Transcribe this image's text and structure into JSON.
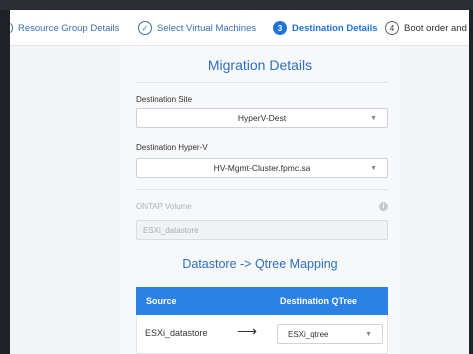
{
  "wizard": {
    "steps": [
      {
        "number": "",
        "label": "Resource Group Details",
        "state": "done"
      },
      {
        "number": "✓",
        "label": "Select Virtual Machines",
        "state": "done"
      },
      {
        "number": "3",
        "label": "Destination Details",
        "state": "active"
      },
      {
        "number": "4",
        "label": "Boot order and",
        "state": "pending"
      }
    ]
  },
  "form": {
    "title": "Migration Details",
    "destination_site": {
      "label": "Destination Site",
      "value": "HyperV-Dest"
    },
    "destination_hyperv": {
      "label": "Destination Hyper-V",
      "value": "HV-Mgmt-Cluster.fpmc.sa"
    },
    "ontap_volume": {
      "label": "ONTAP Volume",
      "placeholder": "ESXi_datastore",
      "info_icon": "i"
    }
  },
  "mapping": {
    "title": "Datastore -> Qtree Mapping",
    "columns": [
      "Source",
      "Destination QTree"
    ],
    "rows": [
      {
        "source": "ESXi_datastore",
        "arrow": "⟶",
        "destination": "ESXi_qtree"
      }
    ]
  },
  "icons": {
    "chevron": "chevron-down-icon",
    "check": "check-circle-icon",
    "info": "info-icon",
    "arrow": "arrow-right-icon"
  },
  "colors": {
    "accent": "#1f74d9",
    "header": "#2a82e4",
    "title": "#2d6fc2"
  }
}
